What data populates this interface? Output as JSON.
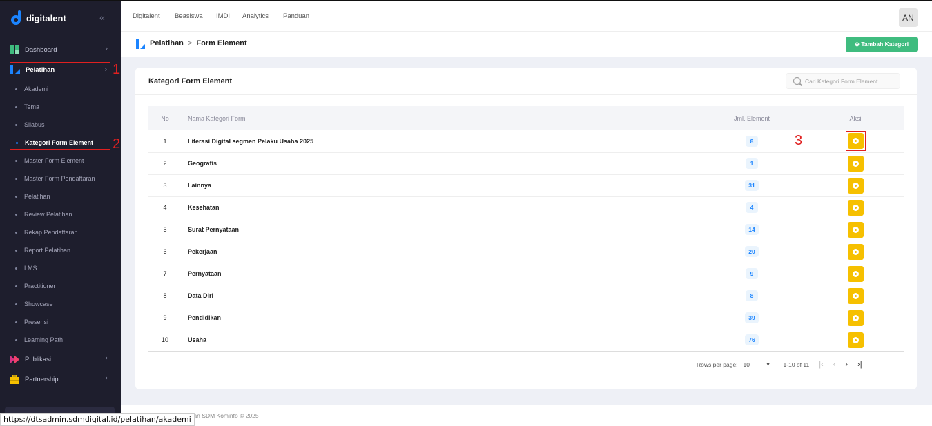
{
  "app": {
    "logo_text": "digitalent"
  },
  "sidebar": {
    "items": [
      {
        "label": "Dashboard"
      },
      {
        "label": "Pelatihan"
      },
      {
        "label": "Publikasi"
      },
      {
        "label": "Partnership"
      }
    ],
    "pelatihan_sub": [
      "Akademi",
      "Tema",
      "Silabus",
      "Kategori Form Element",
      "Master Form Element",
      "Master Form Pendaftaran",
      "Pelatihan",
      "Review Pelatihan",
      "Rekap Pendaftaran",
      "Report Pelatihan",
      "LMS",
      "Practitioner",
      "Showcase",
      "Presensi",
      "Learning Path"
    ],
    "annotations": [
      "1",
      "2"
    ]
  },
  "topnav": {
    "links": [
      "Digitalent",
      "Beasiswa",
      "IMDI",
      "Analytics",
      "Panduan"
    ],
    "avatar": "AN"
  },
  "breadcrumb": {
    "parent": "Pelatihan",
    "separator": ">",
    "current": "Form Element"
  },
  "actions": {
    "add_label": "⊕ Tambah Kategori"
  },
  "card": {
    "title": "Kategori Form Element",
    "search_placeholder": "Cari Kategori Form Element",
    "columns": {
      "no": "No",
      "name": "Nama Kategori Form",
      "jml": "Jml. Element",
      "aksi": "Aksi"
    },
    "rows": [
      {
        "no": "1",
        "name": "Literasi Digital segmen Pelaku Usaha 2025",
        "jml": "8"
      },
      {
        "no": "2",
        "name": "Geografis",
        "jml": "1"
      },
      {
        "no": "3",
        "name": "Lainnya",
        "jml": "31"
      },
      {
        "no": "4",
        "name": "Kesehatan",
        "jml": "4"
      },
      {
        "no": "5",
        "name": "Surat Pernyataan",
        "jml": "14"
      },
      {
        "no": "6",
        "name": "Pekerjaan",
        "jml": "20"
      },
      {
        "no": "7",
        "name": "Pernyataan",
        "jml": "9"
      },
      {
        "no": "8",
        "name": "Data Diri",
        "jml": "8"
      },
      {
        "no": "9",
        "name": "Pendidikan",
        "jml": "39"
      },
      {
        "no": "10",
        "name": "Usaha",
        "jml": "76"
      }
    ],
    "annotation": "3"
  },
  "pager": {
    "rows_per_page_label": "Rows per page:",
    "rows_per_page_value": "10",
    "range": "1-10 of 11"
  },
  "footer": {
    "text": "ngan SDM Kominfo © 2025"
  },
  "statusbar": {
    "url": "https://dtsadmin.sdmdigital.id/pelatihan/akademi"
  },
  "colors": {
    "accent": "#1b84ff",
    "sidebar_bg": "#1e1e2d",
    "action_yellow": "#f6c000",
    "add_green": "#3fbc7f",
    "annotation_red": "#e02020"
  }
}
